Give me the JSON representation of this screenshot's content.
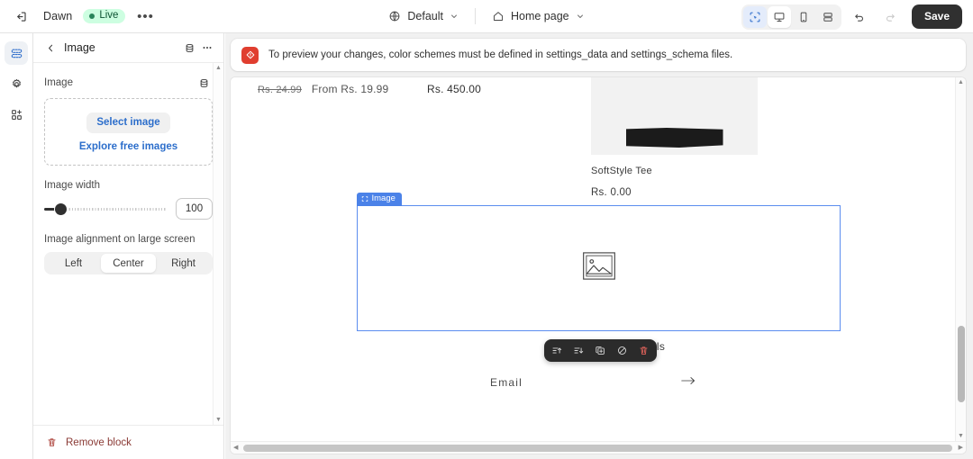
{
  "topbar": {
    "exit_icon": "exit-icon",
    "theme_name": "Dawn",
    "status_badge": "Live",
    "more_label": "•••",
    "scheme_selector": {
      "icon": "globe-icon",
      "label": "Default"
    },
    "page_selector": {
      "icon": "home-icon",
      "label": "Home page"
    },
    "view_buttons": [
      {
        "name": "select-tool",
        "icon": "cursor-select-icon",
        "selected": true
      },
      {
        "name": "desktop-view",
        "icon": "desktop-icon",
        "selected": false
      },
      {
        "name": "mobile-view",
        "icon": "mobile-icon",
        "selected": false
      },
      {
        "name": "fullscreen-view",
        "icon": "fullscreen-icon",
        "selected": false
      }
    ],
    "undo_icon": "undo-icon",
    "redo_icon": "redo-icon",
    "save_label": "Save"
  },
  "rail": {
    "items": [
      {
        "name": "sections-icon",
        "active": true
      },
      {
        "name": "settings-gear-icon",
        "active": false
      },
      {
        "name": "app-blocks-icon",
        "active": false
      }
    ]
  },
  "sidebar": {
    "back_icon": "chevron-left-icon",
    "title": "Image",
    "scheme_icon": "color-scheme-icon",
    "more_icon": "ellipsis-icon",
    "image_section": {
      "label": "Image",
      "scheme_icon": "color-scheme-icon",
      "select_button": "Select image",
      "explore_link": "Explore free images"
    },
    "image_width": {
      "label": "Image width",
      "value": "100",
      "slider_percent": 8
    },
    "alignment": {
      "label": "Image alignment on large screen",
      "options": [
        "Left",
        "Center",
        "Right"
      ],
      "selected": "Center"
    },
    "footer": {
      "icon": "trash-icon",
      "label": "Remove block"
    }
  },
  "banner": {
    "icon": "alert-diamond-icon",
    "text": "To preview your changes, color schemes must be defined in settings_data and settings_schema files."
  },
  "preview": {
    "prices": {
      "compare_at": "Rs. 24.99",
      "from_price": "From Rs. 19.99",
      "other_price": "Rs. 450.00"
    },
    "product": {
      "title": "SoftStyle Tee",
      "price": "Rs. 0.00"
    },
    "image_block": {
      "tag_icon": "image-block-icon",
      "tag_label": "Image",
      "placeholder_icon": "image-placeholder-icon"
    },
    "block_toolbar": [
      {
        "name": "move-up-icon"
      },
      {
        "name": "move-down-icon"
      },
      {
        "name": "duplicate-icon"
      },
      {
        "name": "hide-icon"
      },
      {
        "name": "delete-icon"
      }
    ],
    "obscured_text": "Subscribe to our emails",
    "newsletter": {
      "email_label": "Email",
      "submit_icon": "arrow-right-icon"
    }
  },
  "scrollbars": {
    "up_arrow": "▲",
    "down_arrow": "▼",
    "left_arrow": "◀",
    "right_arrow": "▶"
  }
}
